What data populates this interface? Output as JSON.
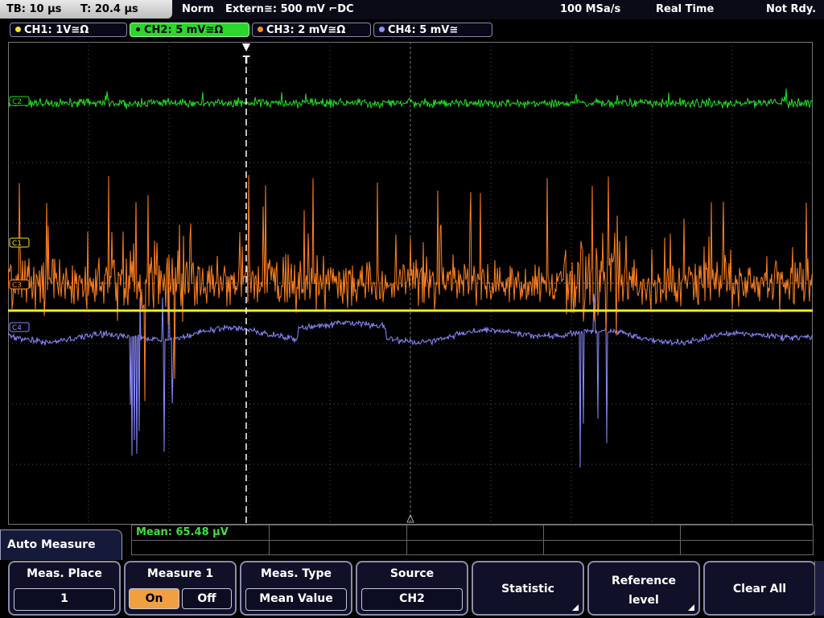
{
  "status_bar": {
    "timebase": "TB: 10 µs",
    "trigger_time": "T: 20.4 µs",
    "trigger_mode": "Norm",
    "trigger_source": "Extern≅: 500 mV ⌐DC",
    "sample_rate": "100 MSa/s",
    "acq_mode": "Real Time",
    "status": "Not Rdy."
  },
  "channels": [
    {
      "label": "CH1: 1V≅Ω",
      "color": "#f2e81a",
      "active": false
    },
    {
      "label": "CH2: 5 mV≅Ω",
      "color": "#2cd62c",
      "active": true
    },
    {
      "label": "CH3: 2 mV≅Ω",
      "color": "#ff8a28",
      "active": false
    },
    {
      "label": "CH4: 5 mV≅",
      "color": "#9090ff",
      "active": false
    }
  ],
  "markers": {
    "c2": "C2",
    "c1": "C1",
    "c3": "C3",
    "c4": "C4",
    "trigger": "T"
  },
  "measurement": {
    "readout": "Mean: 65.48 µV"
  },
  "menu": {
    "title": "Auto Measure",
    "softkeys": {
      "meas_place": {
        "label": "Meas. Place",
        "value": "1"
      },
      "measure": {
        "label": "Measure 1",
        "on": "On",
        "off": "Off"
      },
      "meas_type": {
        "label": "Meas. Type",
        "value": "Mean Value"
      },
      "source": {
        "label": "Source",
        "value": "CH2"
      },
      "statistic": {
        "label": "Statistic"
      },
      "reference": {
        "line1": "Reference",
        "line2": "level"
      },
      "clear_all": {
        "label": "Clear All"
      }
    }
  }
}
